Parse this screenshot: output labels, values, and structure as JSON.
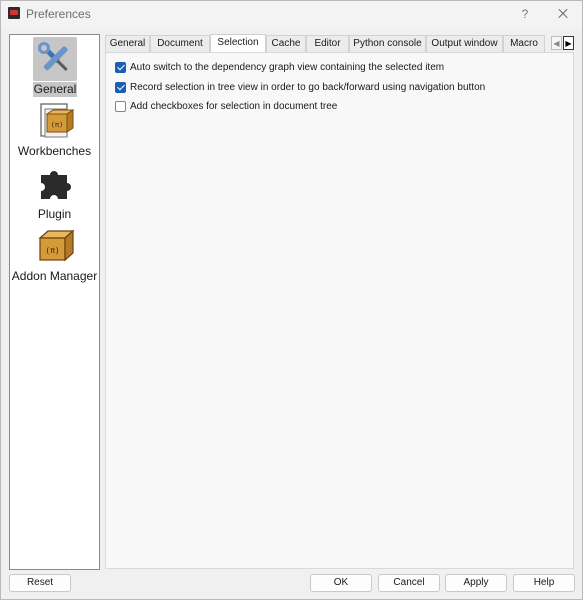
{
  "window": {
    "title": "Preferences",
    "help_label": "?"
  },
  "categories": [
    {
      "label": "General",
      "icon": "tools-icon"
    },
    {
      "label": "Workbenches",
      "icon": "workbenches-icon"
    },
    {
      "label": "Plugin",
      "icon": "puzzle-icon"
    },
    {
      "label": "Addon Manager",
      "icon": "addon-box-icon"
    }
  ],
  "selected_category": "General",
  "tabs": [
    "General",
    "Document",
    "Selection",
    "Cache",
    "Editor",
    "Python console",
    "Output window",
    "Macro"
  ],
  "active_tab": "Selection",
  "tab_scroll": {
    "left": "◀",
    "right": "▶"
  },
  "options": [
    {
      "label": "Auto switch to the dependency graph view containing the selected item",
      "checked": true
    },
    {
      "label": "Record selection in tree view in order to go back/forward using navigation button",
      "checked": true
    },
    {
      "label": "Add checkboxes for selection in document tree",
      "checked": false
    }
  ],
  "buttons": {
    "reset": "Reset",
    "ok": "OK",
    "cancel": "Cancel",
    "apply": "Apply",
    "help": "Help"
  },
  "colors": {
    "accent": "#1a5fb4",
    "selection_bg": "#c6c6c6",
    "icon_blue": "#3b73b9",
    "icon_gold": "#c9902f"
  }
}
